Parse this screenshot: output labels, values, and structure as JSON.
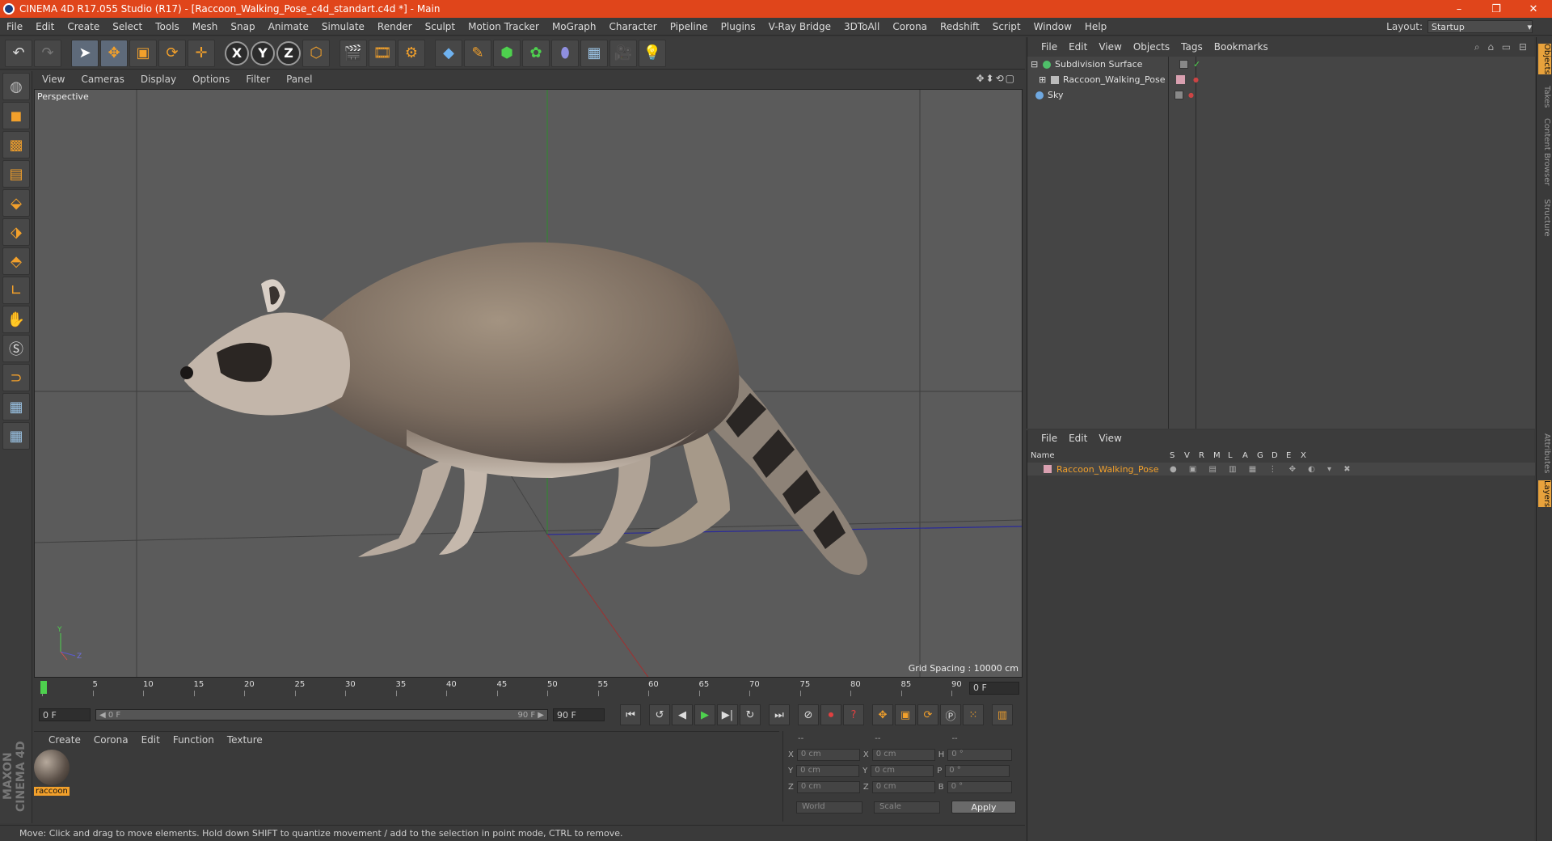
{
  "window": {
    "title": "CINEMA 4D R17.055 Studio (R17) - [Raccoon_Walking_Pose_c4d_standart.c4d *] - Main",
    "minimize": "–",
    "restore": "❐",
    "close": "✕"
  },
  "menu": [
    "File",
    "Edit",
    "Create",
    "Select",
    "Tools",
    "Mesh",
    "Snap",
    "Animate",
    "Simulate",
    "Render",
    "Sculpt",
    "Motion Tracker",
    "MoGraph",
    "Character",
    "Pipeline",
    "Plugins",
    "V-Ray Bridge",
    "3DToAll",
    "Corona",
    "Redshift",
    "Script",
    "Window",
    "Help"
  ],
  "layout": {
    "label": "Layout:",
    "value": "Startup"
  },
  "viewport": {
    "menu": [
      "View",
      "Cameras",
      "Display",
      "Options",
      "Filter",
      "Panel"
    ],
    "nav_icons": "✥⬍⟲▢",
    "label": "Perspective",
    "grid_spacing": "Grid Spacing : 10000 cm",
    "axis_y": "Y",
    "axis_z": "Z"
  },
  "timeline": {
    "ticks": [
      "0",
      "5",
      "10",
      "15",
      "20",
      "25",
      "30",
      "35",
      "40",
      "45",
      "50",
      "55",
      "60",
      "65",
      "70",
      "75",
      "80",
      "85",
      "90"
    ],
    "current_frame": "0 F"
  },
  "transport": {
    "start_field": "0 F",
    "slider_start": "◀ 0 F",
    "slider_end": "90 F ▶",
    "end_field": "90 F"
  },
  "material_manager": {
    "menu": [
      "Create",
      "Corona",
      "Edit",
      "Function",
      "Texture"
    ],
    "material_name": "raccoon"
  },
  "coordinates": {
    "header": [
      "--",
      "--",
      "--"
    ],
    "rows": [
      {
        "a": "X",
        "v1": "0 cm",
        "b": "X",
        "v2": "0 cm",
        "c": "H",
        "v3": "0 °"
      },
      {
        "a": "Y",
        "v1": "0 cm",
        "b": "Y",
        "v2": "0 cm",
        "c": "P",
        "v3": "0 °"
      },
      {
        "a": "Z",
        "v1": "0 cm",
        "b": "Z",
        "v2": "0 cm",
        "c": "B",
        "v3": "0 °"
      }
    ],
    "space": "World",
    "mode": "Scale",
    "apply": "Apply"
  },
  "status": "Move: Click and drag to move elements. Hold down SHIFT to quantize movement / add to the selection in point mode, CTRL to remove.",
  "object_manager": {
    "menu": [
      "File",
      "Edit",
      "View",
      "Objects",
      "Tags",
      "Bookmarks"
    ],
    "objects": [
      {
        "name": "Subdivision Surface",
        "icon_color": "#4fc06a"
      },
      {
        "name": "Raccoon_Walking_Pose",
        "icon_color": "#bbbbbb"
      },
      {
        "name": "Sky",
        "icon_color": "#6fa8e0"
      }
    ]
  },
  "layer_manager": {
    "menu": [
      "File",
      "Edit",
      "View"
    ],
    "columns": [
      "Name",
      "S",
      "V",
      "R",
      "M",
      "L",
      "A",
      "G",
      "D",
      "E",
      "X"
    ],
    "layer_name": "Raccoon_Walking_Pose"
  },
  "side_tabs": [
    "Objects",
    "Takes",
    "Content Browser",
    "Structure",
    "Attributes",
    "Layers"
  ],
  "maxon": "MAXON CINEMA 4D",
  "colors": {
    "accent": "#e0451b",
    "highlight": "#f2a02b"
  }
}
